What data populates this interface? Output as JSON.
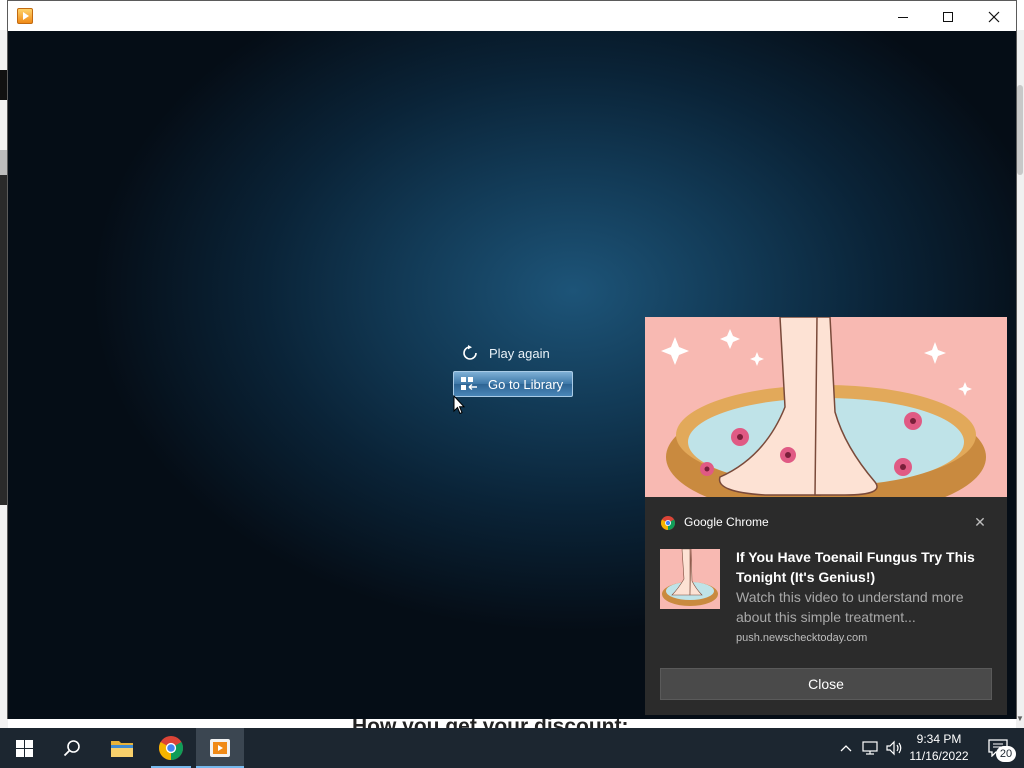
{
  "background_page": {
    "bottom_text": "How you get your discount:"
  },
  "player": {
    "title": "",
    "actions": {
      "play_again": "Play again",
      "go_to_library": "Go to Library"
    },
    "controls": {
      "minimize_icon": "minimize-icon",
      "maximize_icon": "maximize-icon",
      "close_icon": "close-icon"
    },
    "stage_colors": {
      "center": "#1d5478",
      "edge": "#050d16"
    }
  },
  "notification": {
    "app_name": "Google Chrome",
    "title": "If You Have Toenail Fungus Try This Tonight (It's Genius!)",
    "body": "Watch this video to understand more about this simple treatment...",
    "source": "push.newschecktoday.com",
    "close_label": "Close",
    "dismiss_symbol": "✕"
  },
  "taskbar": {
    "items": [
      "start-icon",
      "search-icon",
      "file-explorer-icon",
      "chrome-icon",
      "media-player-icon"
    ],
    "tray": {
      "time": "9:34 PM",
      "date": "11/16/2022",
      "notification_count": "20"
    },
    "colors": {
      "background": "#1c2630",
      "active_underline": "#76b9ed"
    }
  }
}
